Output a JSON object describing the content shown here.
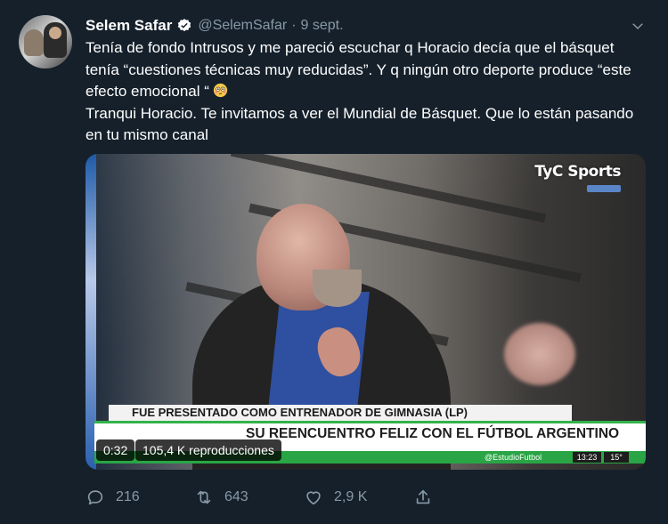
{
  "user": {
    "name": "Selem Safar",
    "handle": "@SelemSafar",
    "date": "9 sept.",
    "separator": "·"
  },
  "tweet": {
    "text_lines": [
      "Tenía de fondo Intrusos y me pareció escuchar q Horacio decía que el básquet tenía “cuestiones técnicas muy reducidas”. Y q ningún otro deporte produce “este efecto emocional “",
      "Tranqui Horacio. Te invitamos a ver el Mundial de Básquet. Que lo están pasando en tu mismo canal"
    ],
    "emoji": "flushed-face"
  },
  "media": {
    "channel_logo": "TyC Sports",
    "lower_third_top": "FUE PRESENTADO COMO ENTRENADOR DE GIMNASIA (LP)",
    "lower_third_main": "SU REENCUENTRO FELIZ CON EL FÚTBOL ARGENTINO",
    "ticker_social": "@EstudioFutbol",
    "ticker_time": "13:23",
    "ticker_temp": "15°",
    "duration": "0:32",
    "views": "105,4 K reproducciones"
  },
  "actions": {
    "replies": "216",
    "retweets": "643",
    "likes": "2,9 K"
  },
  "colors": {
    "background": "#15202b",
    "secondary_text": "#8899a6",
    "verified_badge": "#ffffff",
    "tyc_green": "#2aa546"
  }
}
